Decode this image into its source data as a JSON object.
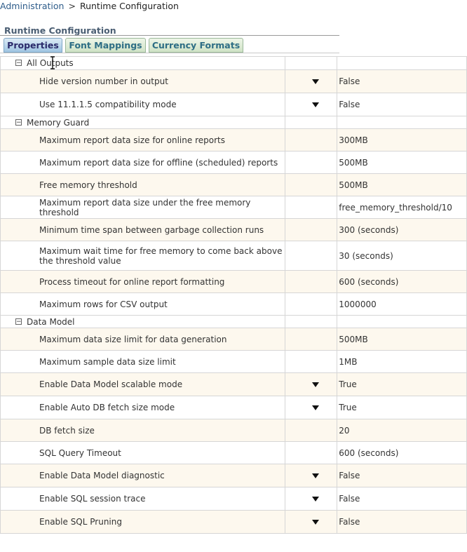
{
  "breadcrumb": {
    "parent": "Administration",
    "separator": ">",
    "current": "Runtime Configuration"
  },
  "page_title": "Runtime Configuration",
  "tabs": [
    {
      "label": "Properties",
      "active": true
    },
    {
      "label": "Font Mappings",
      "active": false
    },
    {
      "label": "Currency Formats",
      "active": false
    }
  ],
  "sections": [
    {
      "title": "All Outputs",
      "rows": [
        {
          "label": "Hide version number in output",
          "value": "False",
          "dropdown": true
        },
        {
          "label": "Use 11.1.1.5 compatibility mode",
          "value": "False",
          "dropdown": true
        }
      ]
    },
    {
      "title": "Memory Guard",
      "rows": [
        {
          "label": "Maximum report data size for online reports",
          "value": "300MB",
          "dropdown": false
        },
        {
          "label": "Maximum report data size for offline (scheduled) reports",
          "value": "500MB",
          "dropdown": false
        },
        {
          "label": "Free memory threshold",
          "value": "500MB",
          "dropdown": false
        },
        {
          "label": "Maximum report data size under the free memory threshold",
          "value": "free_memory_threshold/10",
          "dropdown": false
        },
        {
          "label": "Minimum time span between garbage collection runs",
          "value": "300 (seconds)",
          "dropdown": false
        },
        {
          "label": "Maximum wait time for free memory to come back above the threshold value",
          "value": "30 (seconds)",
          "dropdown": false
        },
        {
          "label": "Process timeout for online report formatting",
          "value": "600 (seconds)",
          "dropdown": false
        },
        {
          "label": "Maximum rows for CSV output",
          "value": "1000000",
          "dropdown": false
        }
      ]
    },
    {
      "title": "Data Model",
      "rows": [
        {
          "label": "Maximum data size limit for data generation",
          "value": "500MB",
          "dropdown": false
        },
        {
          "label": "Maximum sample data size limit",
          "value": "1MB",
          "dropdown": false
        },
        {
          "label": "Enable Data Model scalable mode",
          "value": "True",
          "dropdown": true
        },
        {
          "label": "Enable Auto DB fetch size mode",
          "value": "True",
          "dropdown": true
        },
        {
          "label": "DB fetch size",
          "value": "20",
          "dropdown": false
        },
        {
          "label": "SQL Query Timeout",
          "value": "600 (seconds)",
          "dropdown": false
        },
        {
          "label": "Enable Data Model diagnostic",
          "value": "False",
          "dropdown": true
        },
        {
          "label": "Enable SQL session trace",
          "value": "False",
          "dropdown": true
        },
        {
          "label": "Enable SQL Pruning",
          "value": "False",
          "dropdown": true
        }
      ]
    }
  ]
}
